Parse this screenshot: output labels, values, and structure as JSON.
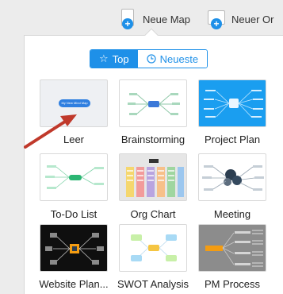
{
  "toolbar": {
    "new_map_label": "Neue Map",
    "new_from_label": "Neuer Or"
  },
  "tabs": {
    "top_label": "Top",
    "newest_label": "Neueste"
  },
  "templates": [
    {
      "label": "Leer",
      "tile_text": "My New Mind Map"
    },
    {
      "label": "Brainstorming"
    },
    {
      "label": "Project Plan"
    },
    {
      "label": "To-Do List"
    },
    {
      "label": "Org Chart"
    },
    {
      "label": "Meeting"
    },
    {
      "label": "Website Plan..."
    },
    {
      "label": "SWOT Analysis"
    },
    {
      "label": "PM Process"
    }
  ],
  "colors": {
    "accent": "#1e90e8",
    "arrow": "#c0392b"
  }
}
